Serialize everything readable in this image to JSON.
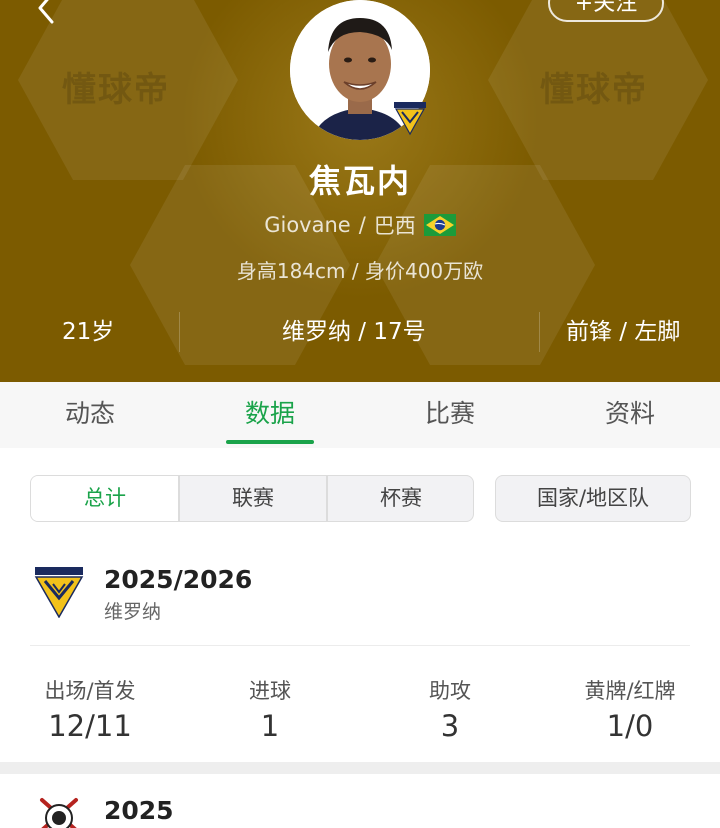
{
  "header": {
    "follow_label": "+关注",
    "watermark": "懂球帝",
    "player_name": "焦瓦内",
    "player_english_name": "Giovane",
    "separator": "/",
    "nationality": "巴西",
    "height_value": "身高184cm / 身价400万欧",
    "age": "21岁",
    "club_number": "维罗纳 / 17号",
    "position_foot": "前锋 / 左脚"
  },
  "tabs": [
    {
      "label": "动态"
    },
    {
      "label": "数据"
    },
    {
      "label": "比赛"
    },
    {
      "label": "资料"
    }
  ],
  "active_tab": "数据",
  "filters": {
    "segments": [
      {
        "label": "总计"
      },
      {
        "label": "联赛"
      },
      {
        "label": "杯赛"
      }
    ],
    "national_team": "国家/地区队"
  },
  "seasons": [
    {
      "year": "2025/2026",
      "team": "维罗纳",
      "stats": [
        {
          "label": "出场/首发",
          "value": "12/11"
        },
        {
          "label": "进球",
          "value": "1"
        },
        {
          "label": "助攻",
          "value": "3"
        },
        {
          "label": "黄牌/红牌",
          "value": "1/0"
        }
      ]
    },
    {
      "year": "2025"
    }
  ],
  "colors": {
    "header_gold": "#7c5b00",
    "accent_green": "#1aa34a",
    "verona_yellow": "#f2c21b",
    "verona_blue": "#1a2a5e"
  },
  "icons": {
    "back": "chevron-left-icon",
    "flag": "brazil-flag-icon",
    "club_logo": "hellas-verona-logo",
    "club_logo_2": "corinthians-logo"
  }
}
